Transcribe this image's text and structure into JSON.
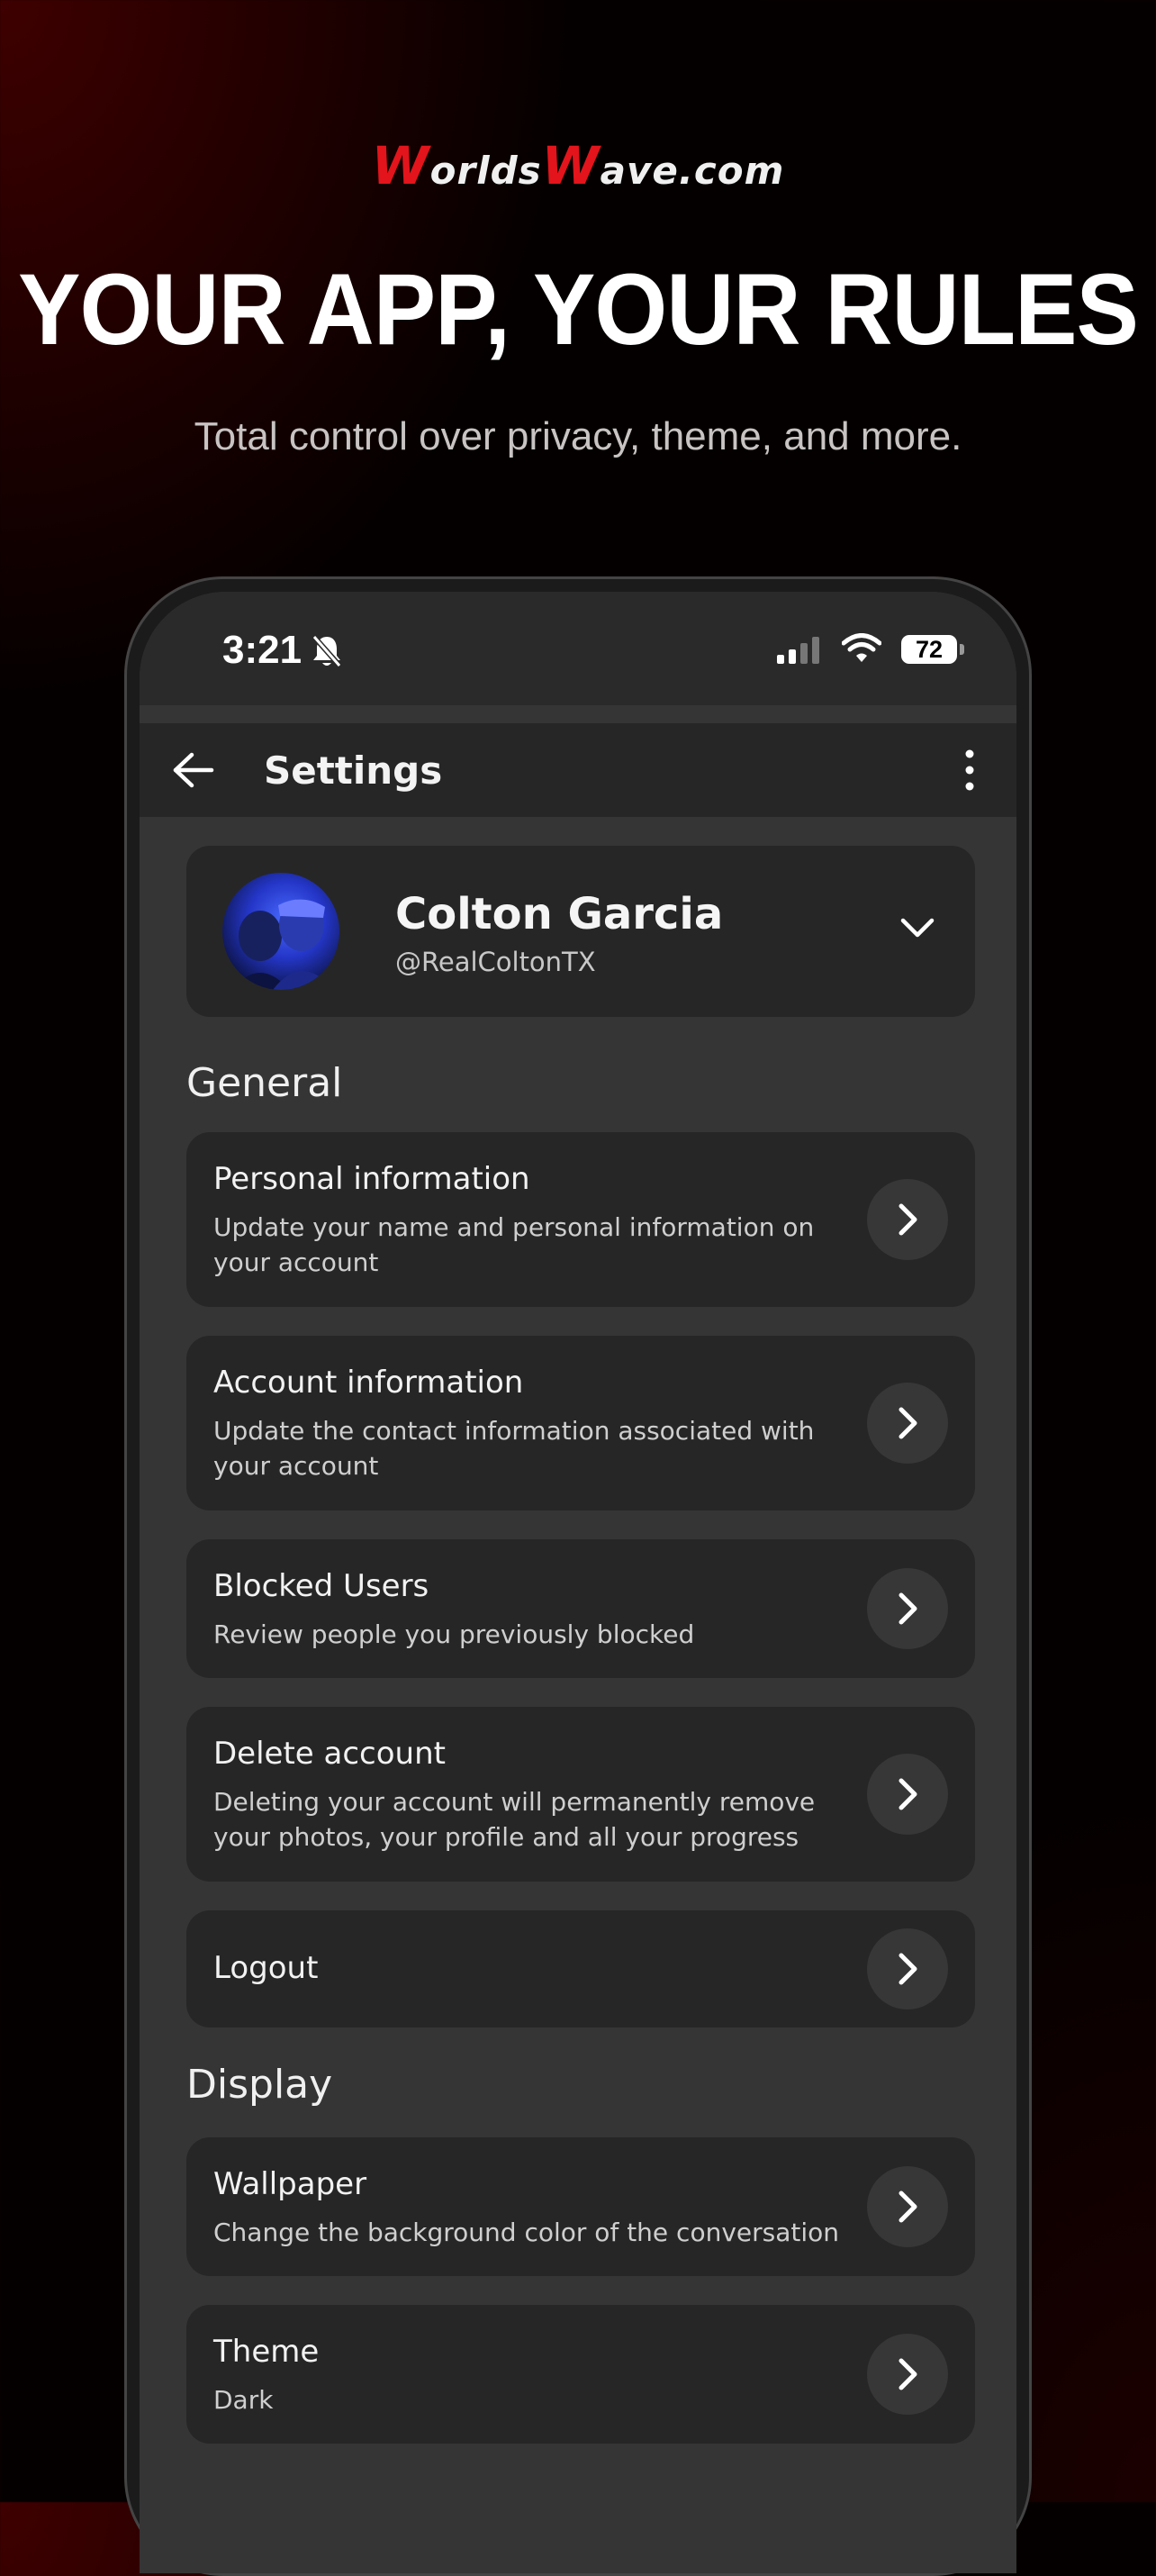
{
  "branding": {
    "logo_prefix_initial": "W",
    "logo_word1": "orlds",
    "logo_mid_initial": "W",
    "logo_word2": "ave.com",
    "headline": "YOUR APP, YOUR RULES",
    "subheadline": "Total control over privacy, theme, and more.",
    "accent_color": "#e3141b"
  },
  "status_bar": {
    "time": "3:21",
    "battery": "72",
    "icons": [
      "bell-off-icon",
      "signal-icon",
      "wifi-icon",
      "battery-icon"
    ]
  },
  "app_bar": {
    "title": "Settings",
    "back_icon": "arrow-left-icon",
    "menu_icon": "more-vertical-icon"
  },
  "profile": {
    "name": "Colton Garcia",
    "handle": "@RealColtonTX"
  },
  "sections": {
    "general": {
      "title": "General",
      "items": [
        {
          "title": "Personal information",
          "description": "Update your name and personal information on your account"
        },
        {
          "title": "Account information",
          "description": "Update the contact information associated with your account"
        },
        {
          "title": "Blocked Users",
          "description": "Review people you previously blocked"
        },
        {
          "title": "Delete account",
          "description": "Deleting your account will permanently remove your photos, your profile and all your progress"
        },
        {
          "title": "Logout",
          "description": ""
        }
      ]
    },
    "display": {
      "title": "Display",
      "items": [
        {
          "title": "Wallpaper",
          "description": "Change the background color of the conversation"
        },
        {
          "title": "Theme",
          "description": "Dark"
        }
      ]
    }
  },
  "colors": {
    "screen_bg": "#353535",
    "card_bg": "#262626",
    "button_bg": "#373737"
  }
}
